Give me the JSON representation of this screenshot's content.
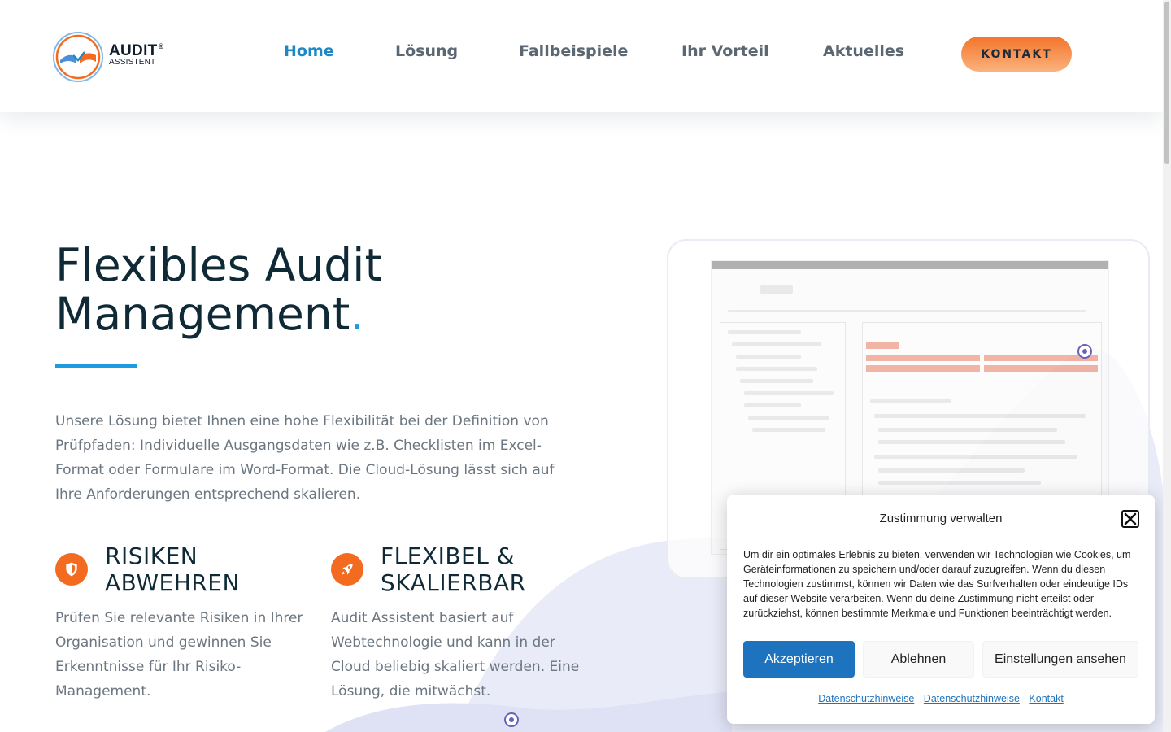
{
  "header": {
    "logo": {
      "name": "AUDIT",
      "registered": "®",
      "tagline": "ASSISTENT"
    },
    "nav": [
      {
        "label": "Home",
        "active": true
      },
      {
        "label": "Lösung",
        "active": false
      },
      {
        "label": "Fallbeispiele",
        "active": false
      },
      {
        "label": "Ihr Vorteil",
        "active": false
      },
      {
        "label": "Aktuelles",
        "active": false
      }
    ],
    "cta_label": "KONTAKT"
  },
  "hero": {
    "title_line1": "Flexibles Audit",
    "title_line2": "Management",
    "title_dot": ".",
    "description": "Unsere Lösung bietet Ihnen eine hohe Flexibilität bei der Definition von Prüfpfaden: Individuelle Ausgangsdaten wie z.B. Checklisten im Excel-Format oder Formulare im Word-Format. Die Cloud-Lösung lässt sich auf Ihre Anforderungen entsprechend skalieren."
  },
  "features": [
    {
      "icon": "shield-icon",
      "title_line1": "RISIKEN",
      "title_line2": "ABWEHREN",
      "text": "Prüfen Sie relevante Risiken in Ihrer Organisation und gewinnen Sie Erkenntnisse für Ihr Risiko-Management."
    },
    {
      "icon": "rocket-icon",
      "title_line1": "FLEXIBEL &",
      "title_line2": "SKALIERBAR",
      "text": "Audit Assistent basiert auf Webtechnologie und kann in der Cloud beliebig skaliert werden. Eine Lösung, die mitwächst."
    }
  ],
  "cookie_dialog": {
    "title": "Zustimmung verwalten",
    "text": "Um dir ein optimales Erlebnis zu bieten, verwenden wir Technologien wie Cookies, um Geräteinformationen zu speichern und/oder darauf zuzugreifen. Wenn du diesen Technologien zustimmst, können wir Daten wie das Surfverhalten oder eindeutige IDs auf dieser Website verarbeiten. Wenn du deine Zustimmung nicht erteilst oder zurückziehst, können bestimmte Merkmale und Funktionen beeinträchtigt werden.",
    "accept_label": "Akzeptieren",
    "deny_label": "Ablehnen",
    "settings_label": "Einstellungen ansehen",
    "links": [
      "Datenschutzhinweise",
      "Datenschutzhinweise",
      "Kontakt"
    ]
  },
  "colors": {
    "accent_blue": "#1e9be0",
    "nav_active": "#1e88c7",
    "cta_orange": "#f3742a",
    "feature_icon": "#f26b21",
    "cookie_primary": "#1e73be",
    "shape_lavender": "#e9ebf8"
  }
}
